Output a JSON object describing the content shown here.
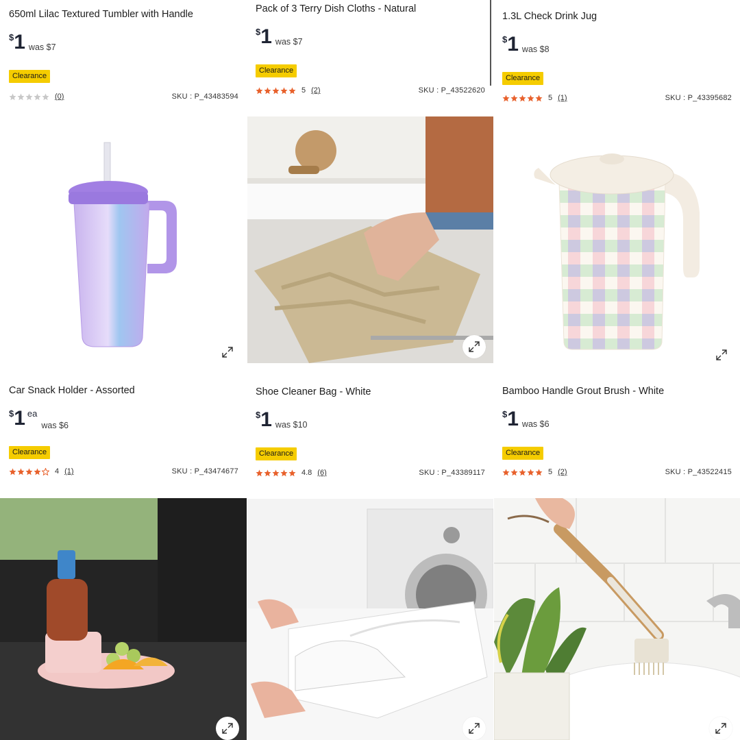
{
  "products": [
    {
      "title": "650ml Lilac Textured Tumbler with Handle",
      "currency": "$",
      "price": "1",
      "unit": "",
      "was": "was $7",
      "badge": "Clearance",
      "rating": 0,
      "rating_text": "",
      "review_count": "(0)",
      "sku": "SKU : P_43483594"
    },
    {
      "title": "Pack of 3 Terry Dish Cloths - Natural",
      "currency": "$",
      "price": "1",
      "unit": "",
      "was": "was $7",
      "badge": "Clearance",
      "rating": 5,
      "rating_text": "5",
      "review_count": "(2)",
      "sku": "SKU : P_43522620"
    },
    {
      "title": "1.3L Check Drink Jug",
      "currency": "$",
      "price": "1",
      "unit": "",
      "was": "was $8",
      "badge": "Clearance",
      "rating": 5,
      "rating_text": "5",
      "review_count": "(1)",
      "sku": "SKU : P_43395682"
    },
    {
      "title": "Car Snack Holder - Assorted",
      "currency": "$",
      "price": "1",
      "unit": "ea",
      "was": "was $6",
      "badge": "Clearance",
      "rating": 4,
      "rating_text": "4",
      "review_count": "(1)",
      "sku": "SKU : P_43474677"
    },
    {
      "title": "Shoe Cleaner Bag - White",
      "currency": "$",
      "price": "1",
      "unit": "",
      "was": "was $10",
      "badge": "Clearance",
      "rating": 4.8,
      "rating_text": "4.8",
      "review_count": "(6)",
      "sku": "SKU : P_43389117"
    },
    {
      "title": "Bamboo Handle Grout Brush - White",
      "currency": "$",
      "price": "1",
      "unit": "",
      "was": "was $6",
      "badge": "Clearance",
      "rating": 5,
      "rating_text": "5",
      "review_count": "(2)",
      "sku": "SKU : P_43522415"
    }
  ],
  "colors": {
    "badge": "#f5cc00",
    "star_filled": "#e8612c",
    "star_empty": "#c8c8c8"
  },
  "icons": {
    "expand": "expand-icon",
    "star": "star-icon"
  }
}
